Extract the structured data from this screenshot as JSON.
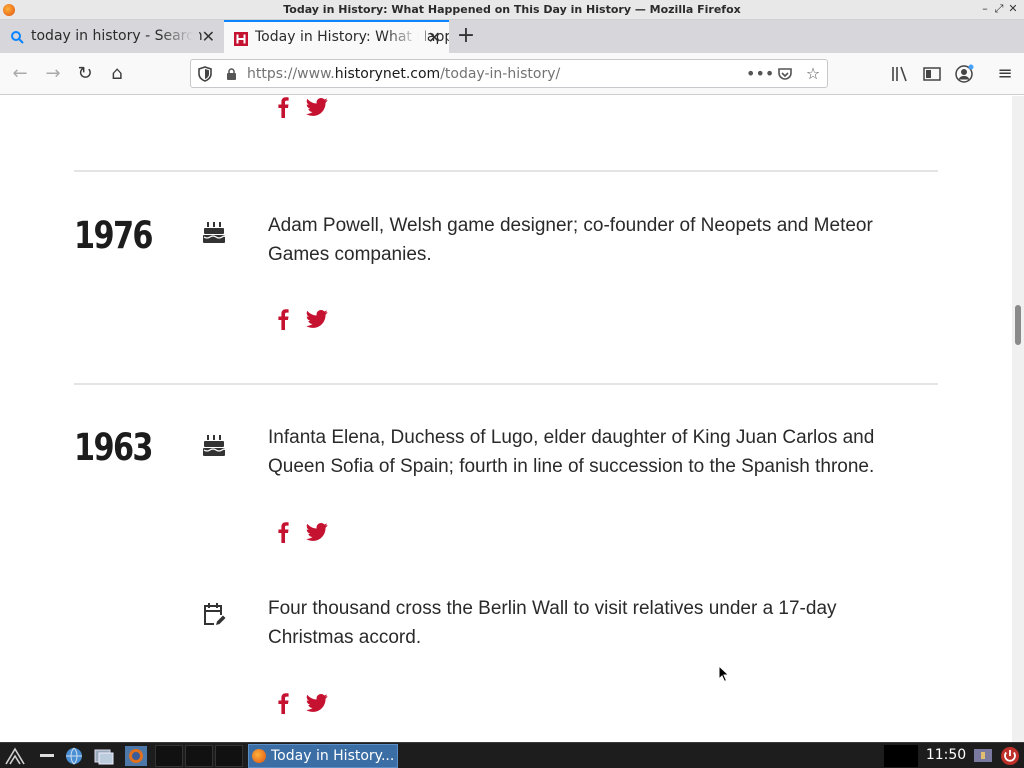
{
  "window": {
    "title": "Today in History: What Happened on This Day in History — Mozilla Firefox"
  },
  "tabs": [
    {
      "label": "today in history - Search",
      "active": false
    },
    {
      "label": "Today in History: What Happened on This Day in History",
      "active": true
    }
  ],
  "navbar": {
    "url_prefix": "https://www.",
    "url_domain": "historynet.com",
    "url_path": "/today-in-history/"
  },
  "accent_color": "#c41230",
  "events": [
    {
      "year": "1976",
      "type": "birth",
      "icon": "birthday-cake-icon",
      "text": "Adam Powell, Welsh game designer; co-founder of Neopets and Meteor Games companies."
    },
    {
      "year": "1963",
      "type": "birth",
      "icon": "birthday-cake-icon",
      "text": "Infanta Elena, Duchess of Lugo, elder daughter of King Juan Carlos and Queen Sofia of Spain; fourth in line of succession to the Spanish throne."
    },
    {
      "year": "",
      "type": "event",
      "icon": "calendar-edit-icon",
      "text": "Four thousand cross the Berlin Wall to visit relatives under a 17-day Christmas accord."
    }
  ],
  "taskbar": {
    "task_label": "Today in History...",
    "clock": "11:50"
  }
}
